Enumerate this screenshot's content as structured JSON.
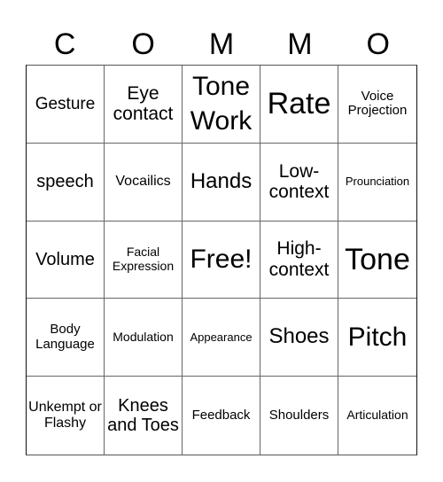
{
  "header": {
    "letters": [
      "C",
      "O",
      "M",
      "M",
      "O"
    ]
  },
  "cells": [
    {
      "text": "Gesture",
      "size": "s19"
    },
    {
      "text": "Eye contact",
      "size": "s21"
    },
    {
      "text": "Tone Work",
      "size": "s30"
    },
    {
      "text": "Rate",
      "size": "s34"
    },
    {
      "text": "Voice Projection",
      "size": "s15"
    },
    {
      "text": "speech",
      "size": "s20"
    },
    {
      "text": "Vocailics",
      "size": "s16"
    },
    {
      "text": "Hands",
      "size": "s24"
    },
    {
      "text": "Low-context",
      "size": "s21"
    },
    {
      "text": "Prounciation",
      "size": "s13"
    },
    {
      "text": "Volume",
      "size": "s20"
    },
    {
      "text": "Facial Expression",
      "size": "s14"
    },
    {
      "text": "Free!",
      "size": "s30"
    },
    {
      "text": "High-context",
      "size": "s21"
    },
    {
      "text": "Tone",
      "size": "s34"
    },
    {
      "text": "Body Language",
      "size": "s15"
    },
    {
      "text": "Modulation",
      "size": "s14"
    },
    {
      "text": "Appearance",
      "size": "s13"
    },
    {
      "text": "Shoes",
      "size": "s24"
    },
    {
      "text": "Pitch",
      "size": "s30"
    },
    {
      "text": "Unkempt or Flashy",
      "size": "s16"
    },
    {
      "text": "Knees and Toes",
      "size": "s20"
    },
    {
      "text": "Feedback",
      "size": "s15"
    },
    {
      "text": "Shoulders",
      "size": "s15"
    },
    {
      "text": "Articulation",
      "size": "s14"
    }
  ]
}
